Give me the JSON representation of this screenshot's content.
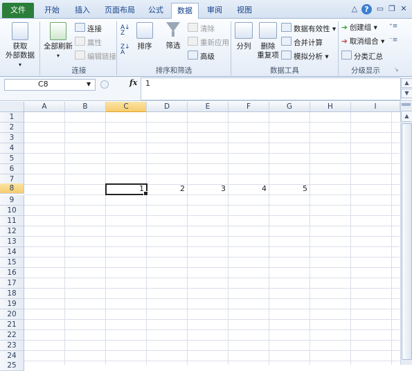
{
  "tabs": [
    "文件",
    "开始",
    "插入",
    "页面布局",
    "公式",
    "数据",
    "审阅",
    "视图"
  ],
  "active_tab": "数据",
  "window": {
    "help": "?",
    "minimize": "▭",
    "restore": "❐",
    "close": "✕",
    "collapse": "△"
  },
  "ribbon": {
    "get_external": {
      "line1": "获取",
      "line2": "外部数据",
      "arrow": "▾"
    },
    "connections": {
      "refresh_all": "全部刷新",
      "connections": "连接",
      "properties": "属性",
      "edit_links": "编辑链接",
      "group_label": "连接"
    },
    "sort_filter": {
      "sort": "排序",
      "filter": "筛选",
      "clear": "清除",
      "reapply": "重新应用",
      "advanced": "高级",
      "group_label": "排序和筛选"
    },
    "data_tools": {
      "text_to_columns": "分列",
      "remove_duplicates_1": "删除",
      "remove_duplicates_2": "重复项",
      "data_validation": "数据有效性",
      "consolidate": "合并计算",
      "what_if": "模拟分析",
      "group_label": "数据工具"
    },
    "outline": {
      "group": "创建组",
      "ungroup": "取消组合",
      "subtotal": "分类汇总",
      "group_label": "分级显示"
    }
  },
  "formula_bar": {
    "name_box": "C8",
    "fx": "fx",
    "value": "1"
  },
  "columns": [
    "A",
    "B",
    "C",
    "D",
    "E",
    "F",
    "G",
    "H",
    "I"
  ],
  "selected_column": "C",
  "rows": [
    "1",
    "2",
    "3",
    "4",
    "5",
    "6",
    "7",
    "8",
    "9",
    "10",
    "11",
    "12",
    "13",
    "14",
    "15",
    "16",
    "17",
    "18",
    "19",
    "20",
    "21",
    "22",
    "23",
    "24",
    "25"
  ],
  "selected_row": "8",
  "cells": {
    "C8": "1",
    "D8": "2",
    "E8": "3",
    "F8": "4",
    "G8": "5"
  },
  "colors": {
    "file_tab": "#2a7e3a",
    "selection_header": "#f6cd6f",
    "accent": "#15428b"
  }
}
